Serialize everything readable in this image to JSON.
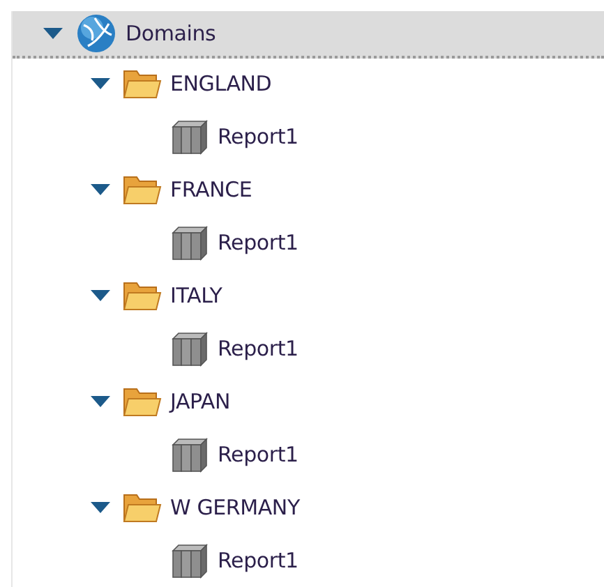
{
  "tree": {
    "label": "Domains",
    "kind": "domain",
    "expanded": true,
    "selected": true,
    "children": [
      {
        "label": "ENGLAND",
        "kind": "folder",
        "expanded": true,
        "selected": false,
        "children": [
          {
            "label": "Report1",
            "kind": "report",
            "selected": false
          }
        ]
      },
      {
        "label": "FRANCE",
        "kind": "folder",
        "expanded": true,
        "selected": false,
        "children": [
          {
            "label": "Report1",
            "kind": "report",
            "selected": false
          }
        ]
      },
      {
        "label": "ITALY",
        "kind": "folder",
        "expanded": true,
        "selected": false,
        "children": [
          {
            "label": "Report1",
            "kind": "report",
            "selected": false
          }
        ]
      },
      {
        "label": "JAPAN",
        "kind": "folder",
        "expanded": true,
        "selected": false,
        "children": [
          {
            "label": "Report1",
            "kind": "report",
            "selected": false
          }
        ]
      },
      {
        "label": "W GERMANY",
        "kind": "folder",
        "expanded": true,
        "selected": false,
        "children": [
          {
            "label": "Report1",
            "kind": "report",
            "selected": false
          }
        ]
      }
    ]
  }
}
